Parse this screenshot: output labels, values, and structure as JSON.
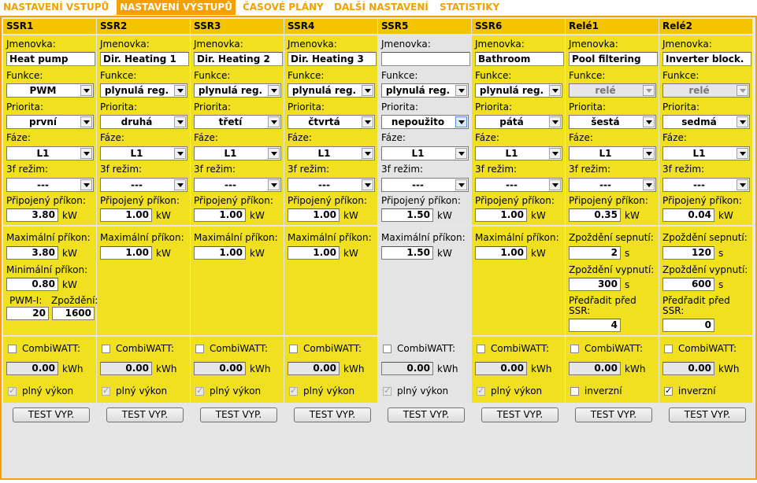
{
  "tabs": [
    "NASTAVENÍ VSTUPŮ",
    "NASTAVENÍ VÝSTUPŮ",
    "ČASOVÉ PLÁNY",
    "DALŠÍ NASTAVENÍ",
    "STATISTIKY"
  ],
  "labels": {
    "name": "Jmenovka:",
    "func": "Funkce:",
    "prio": "Priorita:",
    "phase": "Fáze:",
    "mode3f": "3f režim:",
    "conn": "Připojený příkon:",
    "maxp": "Maximální příkon:",
    "minp": "Minimální příkon:",
    "pwmi": "PWM-I:",
    "delay": "Zpoždění:",
    "don": "Zpoždění sepnutí:",
    "doff": "Zpoždění vypnutí:",
    "pre": "Předřadit před SSR:",
    "combi": "CombiWATT:",
    "full": "plný výkon",
    "inv": "inverzní",
    "test": "TEST VYP.",
    "kw": "kW",
    "kwh": "kWh",
    "s": "s"
  },
  "outputs": [
    {
      "title": "SSR1",
      "name": "Heat pump",
      "func": "PWM",
      "prio": "první",
      "phase": "L1",
      "mode3f": "---",
      "conn": "3.80",
      "maxp": "3.80",
      "minp": "0.80",
      "pwmi": "20",
      "delay": "1600",
      "combi": "0.00",
      "combi_checked": false,
      "flag_checked": true
    },
    {
      "title": "SSR2",
      "name": "Dir. Heating 1",
      "func": "plynulá reg.",
      "prio": "druhá",
      "phase": "L1",
      "mode3f": "---",
      "conn": "1.00",
      "maxp": "1.00",
      "combi": "0.00",
      "combi_checked": false,
      "flag_checked": true
    },
    {
      "title": "SSR3",
      "name": "Dir. Heating 2",
      "func": "plynulá reg.",
      "prio": "třetí",
      "phase": "L1",
      "mode3f": "---",
      "conn": "1.00",
      "maxp": "1.00",
      "combi": "0.00",
      "combi_checked": false,
      "flag_checked": true
    },
    {
      "title": "SSR4",
      "name": "Dir. Heating 3",
      "func": "plynulá reg.",
      "prio": "čtvrtá",
      "phase": "L1",
      "mode3f": "---",
      "conn": "1.00",
      "maxp": "1.00",
      "combi": "0.00",
      "combi_checked": false,
      "flag_checked": true
    },
    {
      "title": "SSR5",
      "name": "",
      "func": "plynulá reg.",
      "prio": "nepoužito",
      "phase": "L1",
      "mode3f": "---",
      "conn": "1.50",
      "maxp": "1.50",
      "combi": "0.00",
      "combi_checked": false,
      "flag_checked": true
    },
    {
      "title": "SSR6",
      "name": "Bathroom",
      "func": "plynulá reg.",
      "prio": "pátá",
      "phase": "L1",
      "mode3f": "---",
      "conn": "1.00",
      "maxp": "1.00",
      "combi": "0.00",
      "combi_checked": false,
      "flag_checked": true
    },
    {
      "title": "Relé1",
      "name": "Pool filtering",
      "func": "relé",
      "prio": "šestá",
      "phase": "L1",
      "mode3f": "---",
      "conn": "0.35",
      "don": "2",
      "doff": "300",
      "pre": "4",
      "combi": "0.00",
      "combi_checked": false,
      "flag_checked": false
    },
    {
      "title": "Relé2",
      "name": "Inverter block.",
      "func": "relé",
      "prio": "sedmá",
      "phase": "L1",
      "mode3f": "---",
      "conn": "0.04",
      "don": "120",
      "doff": "600",
      "pre": "0",
      "combi": "0.00",
      "combi_checked": false,
      "flag_checked": true
    }
  ]
}
